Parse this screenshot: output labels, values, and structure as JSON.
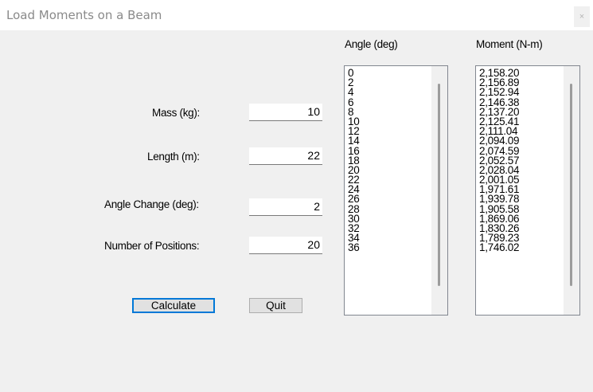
{
  "window": {
    "title": "Load Moments on a Beam",
    "close_glyph": "×"
  },
  "form": {
    "mass": {
      "label": "Mass (kg):",
      "value": "10"
    },
    "length": {
      "label": "Length (m):",
      "value": "22"
    },
    "angle_change": {
      "label": "Angle Change (deg):",
      "value": "2"
    },
    "positions": {
      "label": "Number of Positions:",
      "value": "20"
    }
  },
  "buttons": {
    "calculate": "Calculate",
    "quit": "Quit"
  },
  "angle_list": {
    "header": "Angle (deg)",
    "items": [
      "0",
      "2",
      "4",
      "6",
      "8",
      "10",
      "12",
      "14",
      "16",
      "18",
      "20",
      "22",
      "24",
      "26",
      "28",
      "30",
      "32",
      "34",
      "36"
    ]
  },
  "moment_list": {
    "header": "Moment (N-m)",
    "items": [
      "2,158.20",
      "2,156.89",
      "2,152.94",
      "2,146.38",
      "2,137.20",
      "2,125.41",
      "2,111.04",
      "2,094.09",
      "2,074.59",
      "2,052.57",
      "2,028.04",
      "2,001.05",
      "1,971.61",
      "1,939.78",
      "1,905.58",
      "1,869.06",
      "1,830.26",
      "1,789.23",
      "1,746.02"
    ]
  }
}
